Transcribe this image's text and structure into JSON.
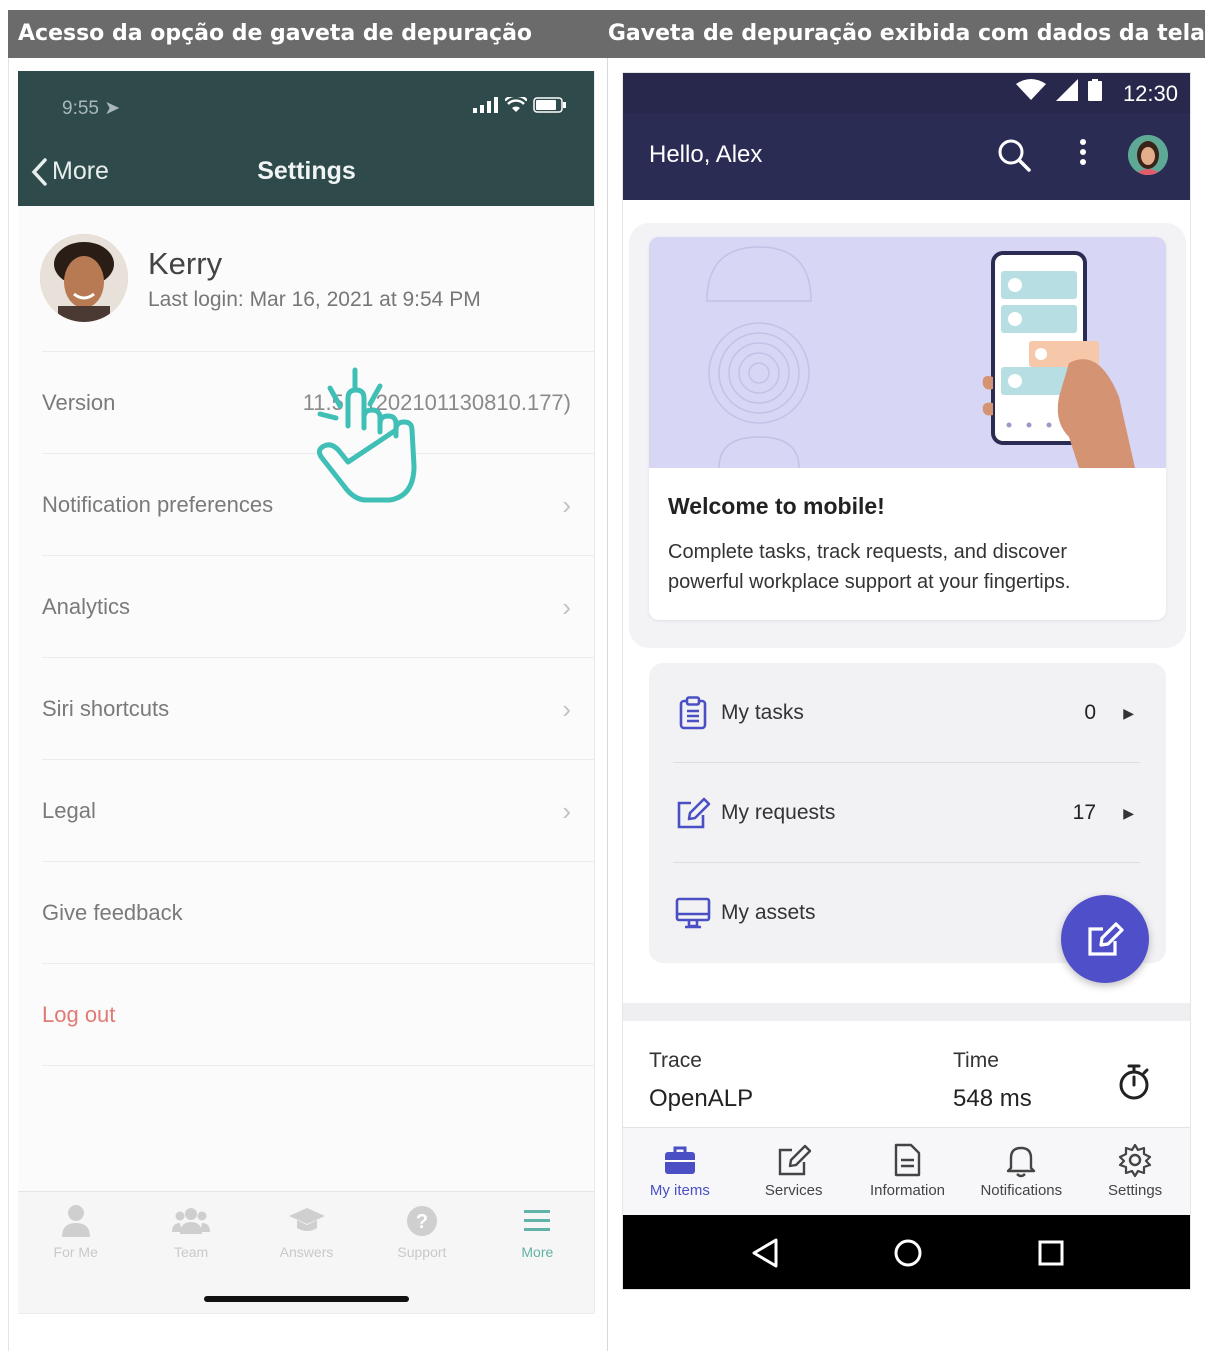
{
  "headers": {
    "left": "Acesso da opção de gaveta de depuração",
    "right": "Gaveta de depuração exibida com dados da tela"
  },
  "ios": {
    "status_time": "9:55",
    "back_label": "More",
    "title": "Settings",
    "profile": {
      "name": "Kerry",
      "last_login": "Last login: Mar 16, 2021 at 9:54 PM"
    },
    "rows": [
      {
        "label": "Version",
        "value": "11.5.0 (202101130810.177)"
      },
      {
        "label": "Notification preferences"
      },
      {
        "label": "Analytics"
      },
      {
        "label": "Siri shortcuts"
      },
      {
        "label": "Legal"
      },
      {
        "label": "Give feedback"
      },
      {
        "label": "Log out"
      }
    ],
    "tabs": [
      "For Me",
      "Team",
      "Answers",
      "Support",
      "More"
    ],
    "active_tab": "More",
    "accent": "#62b3a7",
    "header_bg": "#2e4a4a"
  },
  "android": {
    "status_time": "12:30",
    "greeting": "Hello, Alex",
    "welcome_title": "Welcome to mobile!",
    "welcome_desc": "Complete tasks, track requests, and discover powerful workplace support at your fingertips.",
    "items": [
      {
        "label": "My tasks",
        "count": "0",
        "icon": "clipboard-icon"
      },
      {
        "label": "My requests",
        "count": "17",
        "icon": "edit-icon"
      },
      {
        "label": "My assets",
        "count": "",
        "icon": "monitor-icon"
      }
    ],
    "trace": {
      "label": "Trace",
      "value": "OpenALP"
    },
    "time": {
      "label": "Time",
      "value": "548 ms"
    },
    "nav": [
      "My items",
      "Services",
      "Information",
      "Notifications",
      "Settings"
    ],
    "active_nav": "My items",
    "accent": "#4f4fc9",
    "header_bg": "#2b2c54"
  }
}
